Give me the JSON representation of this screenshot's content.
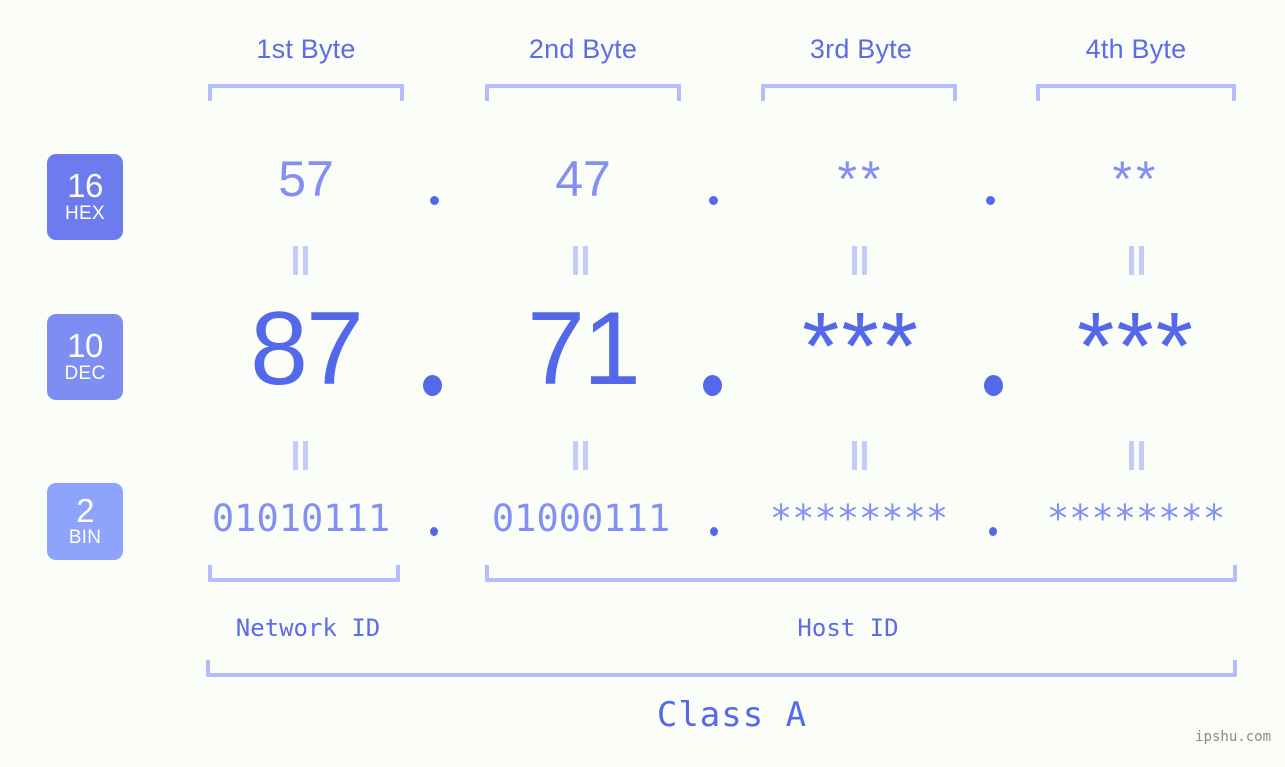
{
  "background_color": "#fbfdf8",
  "colors": {
    "header_text": "#5c6be8",
    "bracket": "#b3bdfb",
    "hex_value": "#8290f3",
    "dec_value": "#5468ea",
    "bin_value": "#8290f3",
    "badge_hex": "#6c7bee",
    "badge_dec": "#7d8df2",
    "badge_bin": "#8ea3fb",
    "eq_bars": "#c3cbfb",
    "watermark": "#8b8b8b"
  },
  "byte_headers": [
    {
      "label": "1st Byte"
    },
    {
      "label": "2nd Byte"
    },
    {
      "label": "3rd Byte"
    },
    {
      "label": "4th Byte"
    }
  ],
  "bases": [
    {
      "number": "16",
      "abbr": "HEX"
    },
    {
      "number": "10",
      "abbr": "DEC"
    },
    {
      "number": "2",
      "abbr": "BIN"
    }
  ],
  "rows": {
    "hex": {
      "base_number": "16",
      "base_abbr": "HEX",
      "values": [
        "57",
        "47",
        "**",
        "**"
      ],
      "separator": "."
    },
    "dec": {
      "base_number": "10",
      "base_abbr": "DEC",
      "values": [
        "87",
        "71",
        "***",
        "***"
      ],
      "separator": "."
    },
    "bin": {
      "base_number": "2",
      "base_abbr": "BIN",
      "values": [
        "01010111",
        "01000111",
        "********",
        "********"
      ],
      "separator": "."
    }
  },
  "equality_marks": {
    "symbol": "=",
    "count_per_gap": 4,
    "gaps": 2
  },
  "id_labels": {
    "network": "Network ID",
    "host": "Host ID"
  },
  "class_label": "Class A",
  "watermark": "ipshu.com"
}
